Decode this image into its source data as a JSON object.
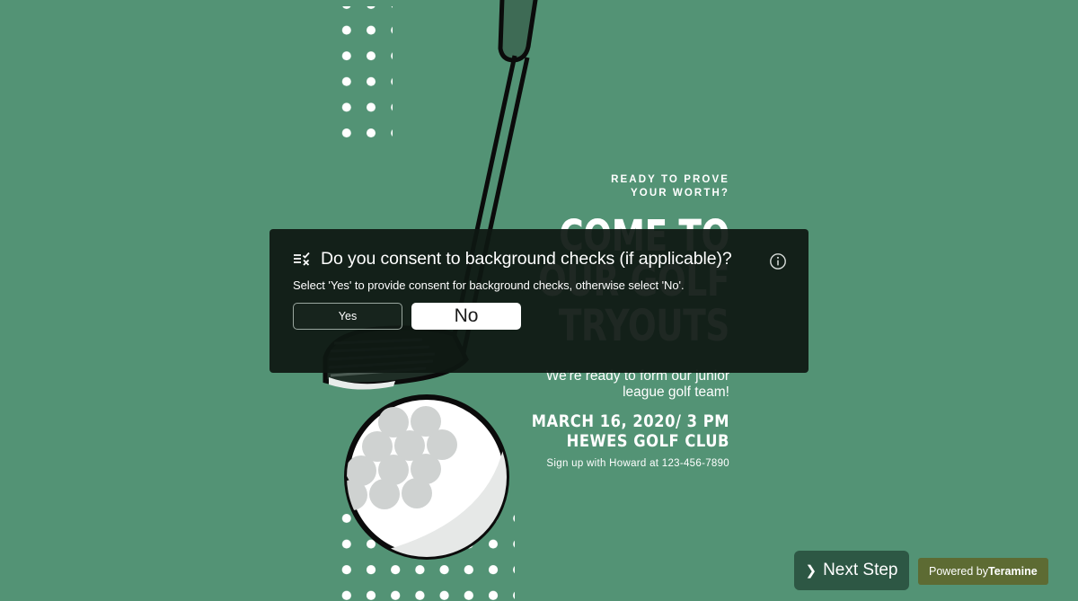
{
  "colors": {
    "page_background": "#539375",
    "modal_background": "#0e1812",
    "next_step_button": "#2d5744",
    "powered_badge": "#5d6b33",
    "selected_choice": "#ffffff",
    "poster_text": "#ffffff"
  },
  "poster": {
    "eyebrow": "READY TO PROVE\nYOUR WORTH?",
    "headline": "COME TO\nOUR GOLF\nTRYOUTS",
    "subhead": "We're ready to form our junior\nleague golf team!",
    "event": "MARCH 16, 2020/ 3 PM\nHEWES GOLF CLUB",
    "signup": "Sign up with Howard at 123-456-7890",
    "art": {
      "golf_ball": "golf-ball-illustration",
      "golf_club": "golf-club-illustration",
      "dot_grid_top": "dot-grid-pattern",
      "dot_grid_bottom": "dot-grid-pattern"
    }
  },
  "modal": {
    "icon": "yes-no-checklist-icon",
    "question": "Do you consent to background checks (if applicable)?",
    "helper": "Select 'Yes' to provide consent for background checks, otherwise select 'No'.",
    "info_icon": "info-circle-icon",
    "choices": [
      {
        "label": "Yes",
        "value": "yes",
        "selected": false
      },
      {
        "label": "No",
        "value": "no",
        "selected": true
      }
    ]
  },
  "footer": {
    "next_step_label": "Next Step",
    "next_step_icon": "chevron-right-icon",
    "powered_prefix": "Powered by",
    "powered_brand": "Teramine"
  }
}
